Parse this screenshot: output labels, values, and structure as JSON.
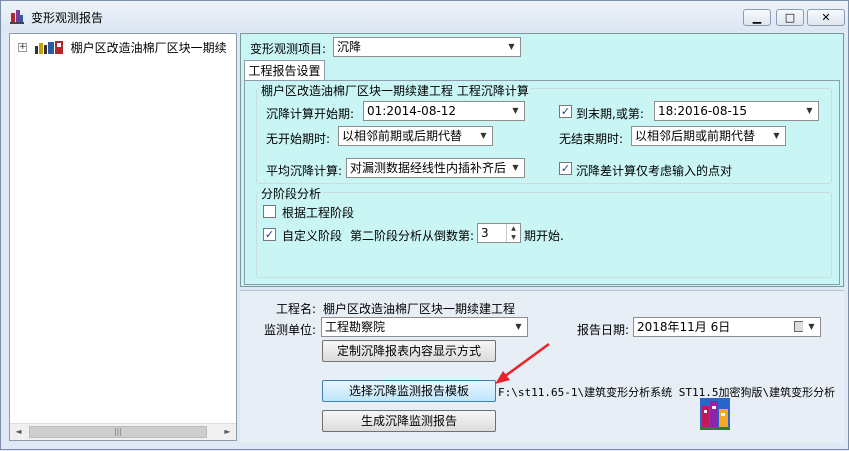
{
  "window": {
    "title": "变形观测报告",
    "minimize_glyph": "▁",
    "maximize_glyph": "□",
    "close_glyph": "✕"
  },
  "tree": {
    "expander": "+",
    "item_label": "棚户区改造油棉厂区块一期续",
    "scroll_left": "◄",
    "scroll_right": "►",
    "scroll_thumb_grip": "|||"
  },
  "top": {
    "project_label": "变形观测项目:",
    "project_value": "沉降",
    "tab_label": "工程报告设置",
    "group1_title": "棚户区改造油棉厂区块一期续建工程 工程沉降计算",
    "start_label": "沉降计算开始期:",
    "start_value": "01:2014-08-12",
    "end_checkbox_label": "到末期,或第:",
    "end_value": "18:2016-08-15",
    "no_start_label": "无开始期时:",
    "no_start_value": "以相邻前期或后期代替",
    "no_end_label": "无结束期时:",
    "no_end_value": "以相邻后期或前期代替",
    "avg_label": "平均沉降计算:",
    "avg_value": "对漏测数据经线性内插补齐后",
    "only_input_label": "沉降差计算仅考虑输入的点对",
    "stage_title": "分阶段分析",
    "by_stage_label": "根据工程阶段",
    "custom_stage_label": "自定义阶段",
    "second_stage_label": "第二阶段分析从倒数第:",
    "second_stage_value": "3",
    "period_start_label": "期开始."
  },
  "bottom": {
    "project_name_label": "工程名:",
    "project_name_value": "棚户区改造油棉厂区块一期续建工程",
    "monitor_unit_label": "监测单位:",
    "monitor_unit_value": "工程勘察院",
    "report_date_label": "报告日期:",
    "report_date_value": "2018年11月 6日",
    "customize_button": "定制沉降报表内容显示方式",
    "select_template_button": "选择沉降监测报告模板",
    "template_path": "F:\\st11.65-1\\建筑变形分析系统 ST11.5加密狗版\\建筑变形分析",
    "generate_button": "生成沉降监测报告"
  },
  "colors": {
    "panel_cyan": "#c9f5f5",
    "annotation_arrow": "#e8242a"
  },
  "icons": {
    "app": "building-app-icon",
    "tree_item": "project-folder-icon",
    "template_preview": "building-thumbnail-icon"
  }
}
